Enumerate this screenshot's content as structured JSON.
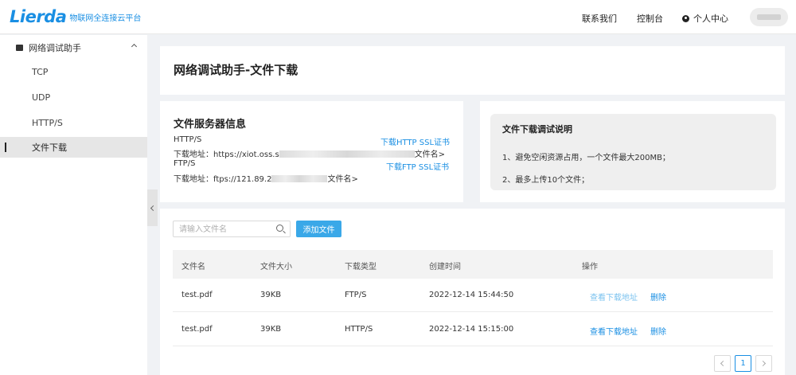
{
  "header": {
    "logo_text": "Lierda",
    "logo_subtitle": "物联网全连接云平台",
    "nav": {
      "contact": "联系我们",
      "console": "控制台",
      "personal_center": "个人中心"
    }
  },
  "sidebar": {
    "group_label": "网络调试助手",
    "items": [
      {
        "label": "TCP"
      },
      {
        "label": "UDP"
      },
      {
        "label": "HTTP/S"
      },
      {
        "label": "文件下载",
        "active": true
      }
    ]
  },
  "page": {
    "title": "网络调试助手-文件下载"
  },
  "server_info": {
    "title": "文件服务器信息",
    "http_label": "HTTP/S",
    "http_addr_prefix": "下载地址：https://xiot.oss.s",
    "http_addr_suffix": "文件名>",
    "ftp_label": "FTP/S",
    "ftp_addr_prefix": "下载地址：ftps://121.89.2",
    "ftp_addr_suffix": "文件名>",
    "http_cert_link": "下载HTTP SSL证书",
    "ftp_cert_link": "下载FTP SSL证书"
  },
  "instructions": {
    "title": "文件下载调试说明",
    "line1": "1、避免空闲资源占用，一个文件最大200MB；",
    "line2": "2、最多上传10个文件；"
  },
  "toolbar": {
    "search_placeholder": "请输入文件名",
    "add_button": "添加文件"
  },
  "table": {
    "headers": [
      "文件名",
      "文件大小",
      "下载类型",
      "创建时间",
      "操作"
    ],
    "rows": [
      {
        "name": "test.pdf",
        "size": "39KB",
        "type": "FTP/S",
        "created": "2022-12-14 15:44:50",
        "view": "查看下载地址",
        "delete": "删除"
      },
      {
        "name": "test.pdf",
        "size": "39KB",
        "type": "HTTP/S",
        "created": "2022-12-14 15:15:00",
        "view": "查看下载地址",
        "delete": "删除"
      }
    ]
  },
  "pagination": {
    "current_page": "1"
  },
  "colors": {
    "accent": "#1a8fe3",
    "button": "#3aa8e8"
  }
}
